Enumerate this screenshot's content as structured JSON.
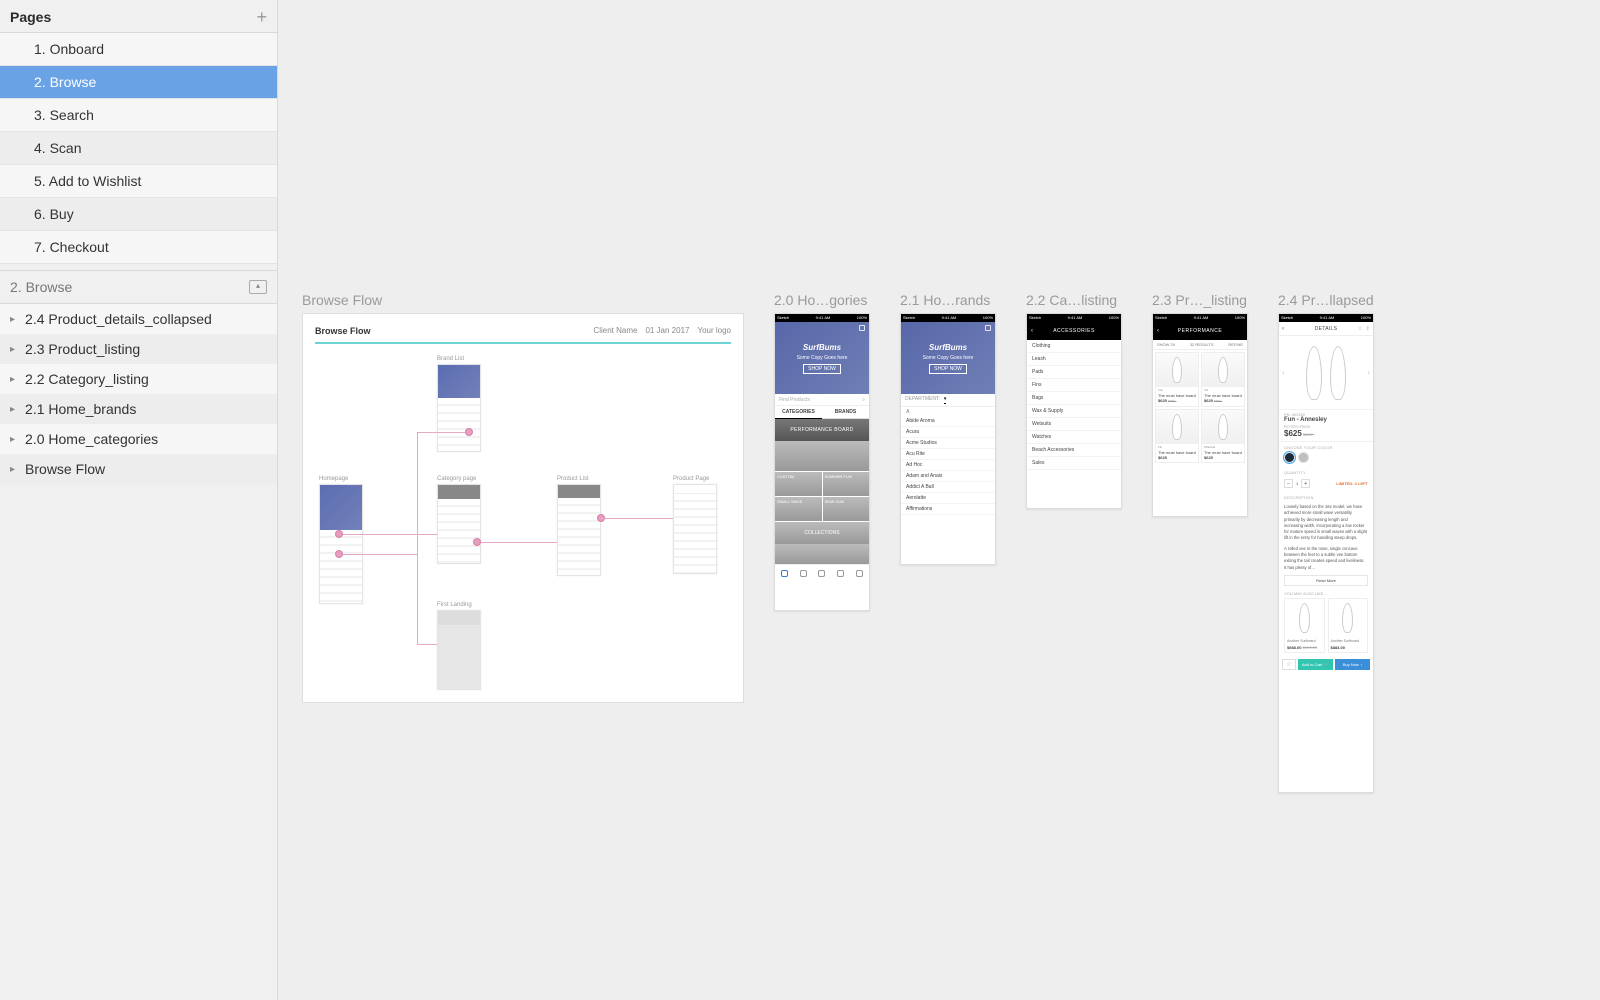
{
  "sidebar": {
    "title": "Pages",
    "pages": [
      {
        "label": "1. Onboard",
        "selected": false
      },
      {
        "label": "2. Browse",
        "selected": true
      },
      {
        "label": "3. Search",
        "selected": false
      },
      {
        "label": "4. Scan",
        "selected": false
      },
      {
        "label": "5. Add to Wishlist",
        "selected": false
      },
      {
        "label": "6. Buy",
        "selected": false
      },
      {
        "label": "7. Checkout",
        "selected": false
      }
    ],
    "current_page_section": "2. Browse",
    "layers": [
      {
        "label": "2.4 Product_details_collapsed"
      },
      {
        "label": "2.3 Product_listing"
      },
      {
        "label": "2.2 Category_listing"
      },
      {
        "label": "2.1 Home_brands"
      },
      {
        "label": "2.0 Home_categories"
      },
      {
        "label": "Browse Flow"
      }
    ]
  },
  "artboards": {
    "browse_flow": {
      "label": "Browse Flow",
      "title": "Browse Flow",
      "client": "Client Name",
      "date": "01 Jan 2017",
      "logo": "Your logo",
      "thumbs": {
        "homepage": "Homepage",
        "brandlist": "Brand List",
        "category": "Category page",
        "productlist": "Product List",
        "productpage": "Product Page",
        "firstlanding": "First Landing"
      }
    },
    "a20": {
      "label": "2.0 Ho…gories",
      "brand": "SurfBums",
      "copy": "Some Copy Goes here",
      "shopnow": "SHOP NOW",
      "search_placeholder": "Find Products",
      "tabs": {
        "categories": "CATEGORIES",
        "brands": "BRANDS"
      },
      "band_perf": "PERFORMANCE BOARD",
      "custom": "CUSTOM",
      "summerfun": "SUMMER FUN",
      "smallwave": "SMALL WAVE",
      "semigun": "SEMI GUN",
      "collections": "COLLECTIONS"
    },
    "a21": {
      "label": "2.1 Ho…rands",
      "brand": "SurfBums",
      "copy": "Some Copy Goes here",
      "shopnow": "SHOP NOW",
      "department": "DEPARTMENT:",
      "section": "A",
      "brands": [
        "Abide Aroma",
        "Acura",
        "Acme Studios",
        "Acu Rite",
        "Ad Hoc",
        "Adam and Anais",
        "Addict A Ball",
        "Aerolatte",
        "Affirmations"
      ]
    },
    "a22": {
      "label": "2.2 Ca…listing",
      "header": "ACCESSORIES",
      "items": [
        "Clothing",
        "Leash",
        "Pads",
        "Fins",
        "Bags",
        "Wax & Supply",
        "Wetsuits",
        "Watches",
        "Beach Accessories",
        "Sales"
      ]
    },
    "a23": {
      "label": "2.3 Pr…_listing",
      "header": "PERFORMANCE",
      "show": "SHOW 20",
      "results": "32 RESULTS",
      "refine": "REFINE",
      "cards": [
        {
          "tag": "Fun",
          "name": "The must have board",
          "price": "$625",
          "old": "$950+"
        },
        {
          "tag": "3.6",
          "name": "The must have board",
          "price": "$625",
          "old": "$950+"
        },
        {
          "tag": "Fin",
          "name": "The must have board",
          "price": "$625"
        },
        {
          "tag": "Phasma",
          "name": "The must have board",
          "price": "$625"
        }
      ]
    },
    "a24": {
      "label": "2.4 Pr…llapsed",
      "header": "DETAILS",
      "pn": "PN: #00152",
      "name": "Fun - Annesley",
      "price_label": "PETER'S PRICE",
      "price": "$625",
      "old": "$650+",
      "choose_color": "CHOOSE YOUR COLOR",
      "quantity_label": "QUANTITY",
      "qty_value": "1",
      "limited": "LIMITED: 3 LEFT",
      "desc_label": "DESCRIPTION",
      "desc1": "Loosely based on the 16x model, we have achieved more small wave versatility primarily by decreasing length and increasing width. Incorporating a low rocker for mature speed in small waves with a slight lift in the entry for handling steep drops.",
      "desc2": "A rolled vee in the nose, single concave between the feet to a subtle vee bottom exiting the tail creates speed and liveliness. It has plenty of…",
      "readmore": "Read More",
      "also_label": "YOU MAY ALSO LIKE…",
      "also": [
        {
          "name": "Another Surfboard",
          "price": "$988.00",
          "old": "$999.00"
        },
        {
          "name": "Another Surfboard",
          "price": "$883.00"
        }
      ],
      "addcart": "Add to Cart",
      "buynow": "Buy Now"
    },
    "status": {
      "carrier": "Sketch",
      "time": "9:41 AM",
      "batt": "100%"
    }
  }
}
